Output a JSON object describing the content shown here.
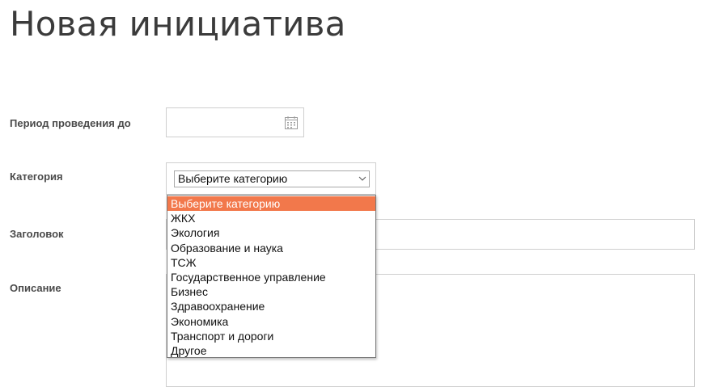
{
  "page": {
    "title": "Новая инициатива"
  },
  "form": {
    "period_label": "Период проведения до",
    "period_value": "",
    "category_label": "Категория",
    "category_selected": "Выберите категорию",
    "title_label": "Заголовок",
    "title_value": "",
    "description_label": "Описание",
    "description_value": ""
  },
  "category_options": [
    "Выберите категорию",
    "ЖКХ",
    "Экология",
    "Образование и наука",
    "ТСЖ",
    "Государственное управление",
    "Бизнес",
    "Здравоохранение",
    "Экономика",
    "Транспорт и дороги",
    "Другое"
  ],
  "colors": {
    "highlight": "#f2784b",
    "border": "#cfcfcf",
    "title_text": "#3b3b3b"
  },
  "icons": {
    "date": "calendar-icon",
    "select": "chevron-down-icon"
  }
}
